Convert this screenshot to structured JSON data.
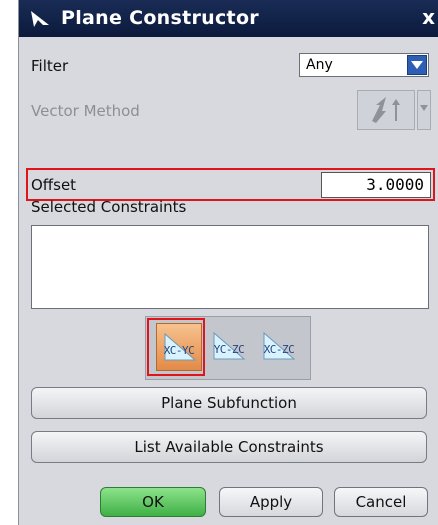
{
  "window": {
    "title": "Plane Constructor",
    "close_glyph": "x",
    "title_icon": "arrow-icon"
  },
  "filter": {
    "label": "Filter",
    "value": "Any"
  },
  "vector_method": {
    "label": "Vector Method",
    "icon": "vector-method-icon"
  },
  "offset": {
    "label": "Offset",
    "value": "3.0000"
  },
  "selected_constraints": {
    "label": "Selected Constraints",
    "items": []
  },
  "plane_buttons": [
    {
      "label": "XC-YC",
      "active": true
    },
    {
      "label": "YC-ZC",
      "active": false
    },
    {
      "label": "XC-ZC",
      "active": false
    }
  ],
  "actions": {
    "plane_subfunction": "Plane Subfunction",
    "list_available_constraints": "List Available Constraints"
  },
  "footer": {
    "ok": "OK",
    "apply": "Apply",
    "cancel": "Cancel"
  },
  "colors": {
    "highlight": "#e0151b",
    "titlebar": "#0b1a3c",
    "ok_button": "#3fb046",
    "active_plane": "#e38a48"
  }
}
